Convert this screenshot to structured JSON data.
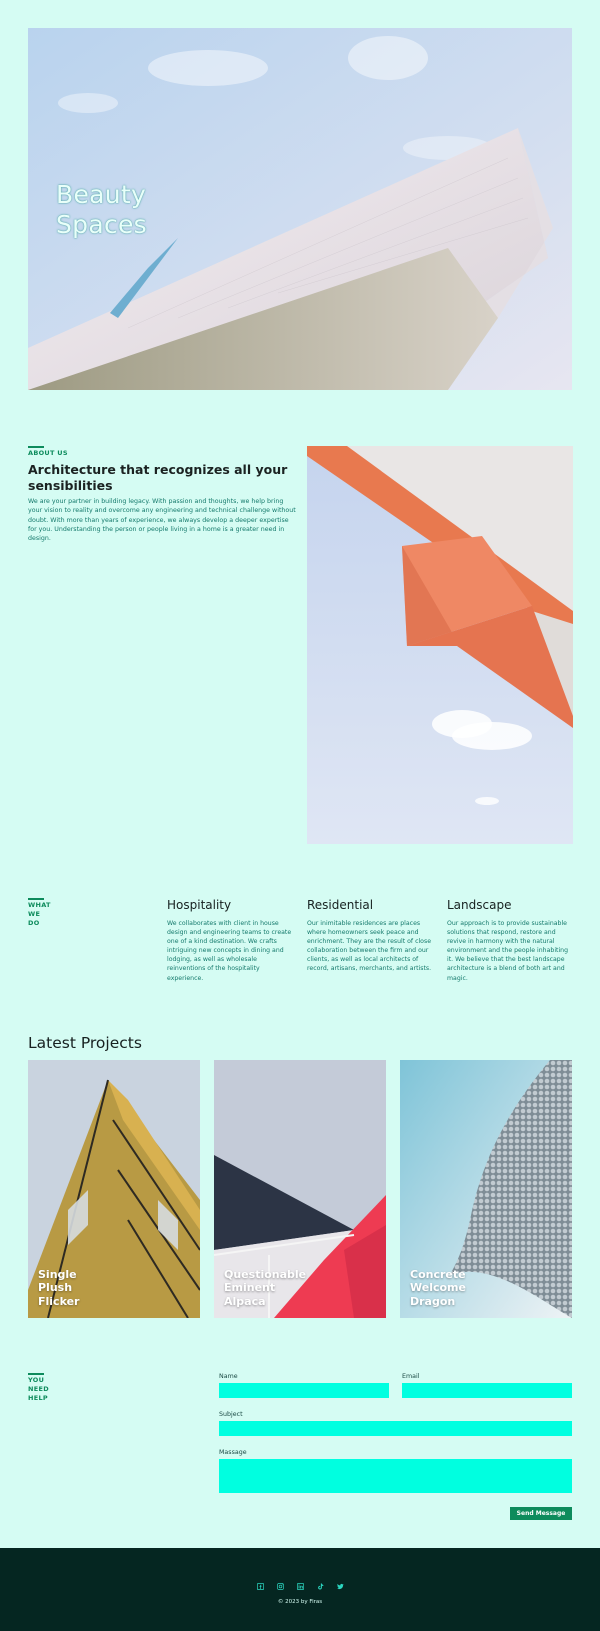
{
  "hero": {
    "title_line1": "Beauty",
    "title_line2": "Spaces"
  },
  "about": {
    "eyebrow": "ABOUT US",
    "heading": "Architecture that recognizes all your sensibilities",
    "text": "We are your partner in building legacy. With passion and thoughts, we help bring your vision to reality and overcome any engineering and technical challenge without doubt. With more than years of experience, we always develop a deeper expertise for you. Understanding the person or people living in a home is a greater need in design."
  },
  "services": {
    "eyebrow_line1": "WHAT",
    "eyebrow_line2": "WE",
    "eyebrow_line3": "DO",
    "items": [
      {
        "title": "Hospitality",
        "text": "We collaborates with client in house design and engineering teams to create one of a kind destination. We crafts intriguing new concepts in dining and lodging, as well as wholesale reinventions of the hospitality experience."
      },
      {
        "title": "Residential",
        "text": "Our inimitable residences are places where homeowners seek peace and enrichment. They are the result of close collaboration between the firm and our clients, as well as local architects of record, artisans, merchants, and artists."
      },
      {
        "title": "Landscape",
        "text": "Our approach is to provide sustainable solutions that respond, restore and revive in harmony with the natural environment and the people inhabiting it. We believe that the best landscape architecture is a blend of both art and magic."
      }
    ]
  },
  "projects": {
    "title": "Latest Projects",
    "items": [
      {
        "line1": "Single",
        "line2": "Plush",
        "line3": "Flicker"
      },
      {
        "line1": "Questionable",
        "line2": "Eminent",
        "line3": "Alpaca"
      },
      {
        "line1": "Concrete",
        "line2": "Welcome",
        "line3": "Dragon"
      }
    ]
  },
  "contact": {
    "eyebrow_line1": "YOU",
    "eyebrow_line2": "NEED",
    "eyebrow_line3": "HELP",
    "name_label": "Name",
    "email_label": "Email",
    "subject_label": "Subject",
    "message_label": "Massage",
    "send_label": "Send Message"
  },
  "footer": {
    "social_icons": [
      "facebook-icon",
      "instagram-icon",
      "linkedin-icon",
      "tiktok-icon",
      "twitter-icon"
    ],
    "copyright": "© 2023 by Firas"
  },
  "colors": {
    "background": "#d5fcf3",
    "accent": "#0d8b5c",
    "field": "#00ffe0",
    "footer": "#052621",
    "body_text": "#157a6c"
  }
}
